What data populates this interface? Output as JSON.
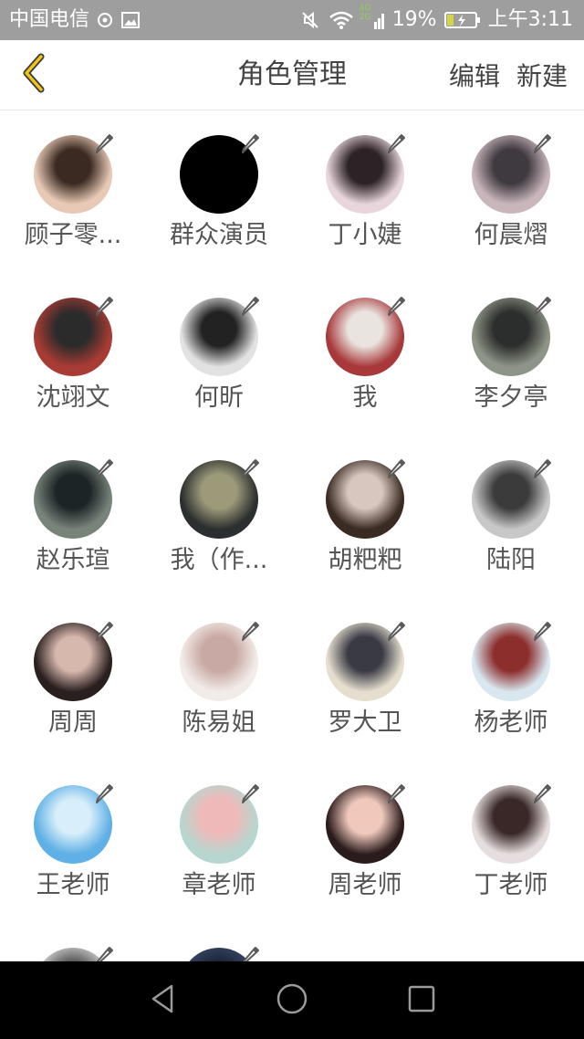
{
  "status_bar": {
    "carrier": "中国电信",
    "network": "4G 2G",
    "battery": "19%",
    "time": "上午3:11"
  },
  "header": {
    "title": "角色管理",
    "edit_label": "编辑",
    "new_label": "新建",
    "back_icon": "chevron-left-icon",
    "accent_color": "#e6b800"
  },
  "roles": [
    {
      "name": "顾子零...",
      "colors": [
        "#e8c9b5",
        "#3a2a22"
      ]
    },
    {
      "name": "群众演员",
      "colors": [
        "#000000",
        "#000000"
      ]
    },
    {
      "name": "丁小婕",
      "colors": [
        "#e8d6dc",
        "#2d2326"
      ]
    },
    {
      "name": "何晨熠",
      "colors": [
        "#c9b6bb",
        "#3f3940"
      ]
    },
    {
      "name": "沈翊文",
      "colors": [
        "#a83b34",
        "#2b2b2b"
      ]
    },
    {
      "name": "何昕",
      "colors": [
        "#e2e2e2",
        "#222222"
      ]
    },
    {
      "name": "我",
      "colors": [
        "#a8383a",
        "#e9e4df"
      ]
    },
    {
      "name": "李夕亭",
      "colors": [
        "#8e9487",
        "#2b2e2c"
      ]
    },
    {
      "name": "赵乐瑄",
      "colors": [
        "#78837a",
        "#1d2426"
      ]
    },
    {
      "name": "我（作...",
      "colors": [
        "#2b2f2f",
        "#9d9a7a"
      ]
    },
    {
      "name": "胡粑粑",
      "colors": [
        "#3a2b22",
        "#d8c7bf"
      ]
    },
    {
      "name": "陆阳",
      "colors": [
        "#c8c8c8",
        "#3b3b3b"
      ]
    },
    {
      "name": "周周",
      "colors": [
        "#2a1f1f",
        "#d7b8ad"
      ]
    },
    {
      "name": "陈易姐",
      "colors": [
        "#f2ece8",
        "#c9a9a4"
      ]
    },
    {
      "name": "罗大卫",
      "colors": [
        "#e6dfcf",
        "#3a3a45"
      ]
    },
    {
      "name": "杨老师",
      "colors": [
        "#d9e8f0",
        "#8c2f2c"
      ]
    },
    {
      "name": "王老师",
      "colors": [
        "#5fb0e6",
        "#d8eefa"
      ]
    },
    {
      "name": "章老师",
      "colors": [
        "#b7d6cf",
        "#f0b9b9"
      ]
    },
    {
      "name": "周老师",
      "colors": [
        "#2a1c1c",
        "#f0c8bc"
      ]
    },
    {
      "name": "丁老师",
      "colors": [
        "#e6dede",
        "#3a2828"
      ]
    },
    {
      "name": "",
      "colors": [
        "#d8d8d8",
        "#555555"
      ]
    },
    {
      "name": "",
      "colors": [
        "#3b4a6b",
        "#1c2438"
      ]
    }
  ],
  "nav": {
    "back_icon": "triangle-back-icon",
    "home_icon": "circle-home-icon",
    "recent_icon": "square-recent-icon"
  }
}
